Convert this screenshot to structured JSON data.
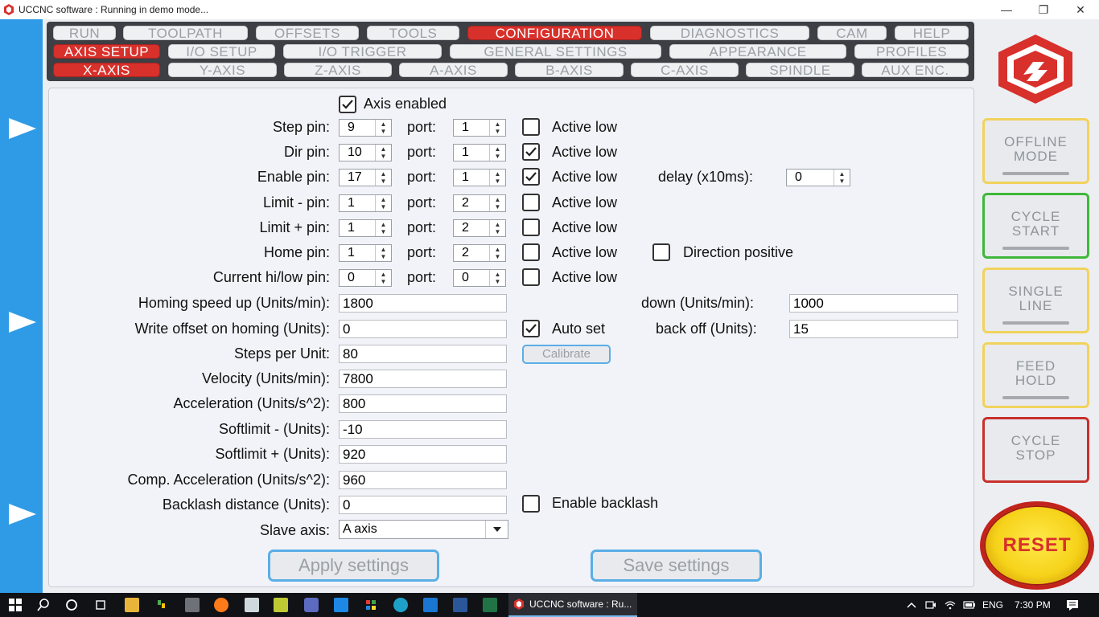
{
  "window": {
    "title": "UCCNC software : Running in demo mode...",
    "minimize": "—",
    "maximize": "❐",
    "close": "✕"
  },
  "menu": {
    "row1": [
      "RUN",
      "TOOLPATH",
      "OFFSETS",
      "TOOLS",
      "CONFIGURATION",
      "DIAGNOSTICS",
      "CAM",
      "HELP"
    ],
    "row2": [
      "AXIS SETUP",
      "I/O SETUP",
      "I/O  TRIGGER",
      "GENERAL SETTINGS",
      "APPEARANCE",
      "PROFILES"
    ],
    "row3": [
      "X-AXIS",
      "Y-AXIS",
      "Z-AXIS",
      "A-AXIS",
      "B-AXIS",
      "C-AXIS",
      "SPINDLE",
      "AUX ENC."
    ]
  },
  "form": {
    "axis_enabled": "Axis enabled",
    "port_label": "port:",
    "active_low": "Active low",
    "pins": [
      {
        "label": "Step pin:",
        "pin": "9",
        "port": "1",
        "active_low": false
      },
      {
        "label": "Dir pin:",
        "pin": "10",
        "port": "1",
        "active_low": true
      },
      {
        "label": "Enable pin:",
        "pin": "17",
        "port": "1",
        "active_low": true
      },
      {
        "label": "Limit - pin:",
        "pin": "1",
        "port": "2",
        "active_low": false
      },
      {
        "label": "Limit + pin:",
        "pin": "1",
        "port": "2",
        "active_low": false
      },
      {
        "label": "Home pin:",
        "pin": "1",
        "port": "2",
        "active_low": false
      },
      {
        "label": "Current hi/low pin:",
        "pin": "0",
        "port": "0",
        "active_low": false
      }
    ],
    "delay_label": "delay (x10ms):",
    "delay_value": "0",
    "direction_positive": "Direction positive",
    "homing_up_label": "Homing speed up (Units/min):",
    "homing_up_value": "1800",
    "homing_down_label": "down (Units/min):",
    "homing_down_value": "1000",
    "write_offset_label": "Write offset on homing (Units):",
    "write_offset_value": "0",
    "auto_set": "Auto set",
    "back_off_label": "back off (Units):",
    "back_off_value": "15",
    "steps_label": "Steps per Unit:",
    "steps_value": "80",
    "calibrate": "Calibrate",
    "velocity_label": "Velocity (Units/min):",
    "velocity_value": "7800",
    "accel_label": "Acceleration (Units/s^2):",
    "accel_value": "800",
    "soft_minus_label": "Softlimit - (Units):",
    "soft_minus_value": "-10",
    "soft_plus_label": "Softlimit + (Units):",
    "soft_plus_value": "920",
    "comp_accel_label": "Comp. Acceleration (Units/s^2):",
    "comp_accel_value": "960",
    "backlash_label": "Backlash distance (Units):",
    "backlash_value": "0",
    "enable_backlash": "Enable backlash",
    "slave_label": "Slave axis:",
    "slave_value": "A axis",
    "apply": "Apply settings",
    "save": "Save settings"
  },
  "side": {
    "offline": [
      "OFFLINE",
      "MODE"
    ],
    "cycle_start": [
      "CYCLE",
      "START"
    ],
    "single_line": [
      "SINGLE",
      "LINE"
    ],
    "feed_hold": [
      "FEED",
      "HOLD"
    ],
    "cycle_stop": [
      "CYCLE",
      "STOP"
    ],
    "reset": "RESET"
  },
  "taskbar": {
    "app_label": "UCCNC software : Ru...",
    "lang": "ENG",
    "time": "7:30 PM"
  },
  "colors": {
    "accent_red": "#d8302b",
    "left_blue": "#2f9be6",
    "start_green": "#3fb83a",
    "hold_yellow": "#f1d35c",
    "stop_red": "#c9302c"
  }
}
